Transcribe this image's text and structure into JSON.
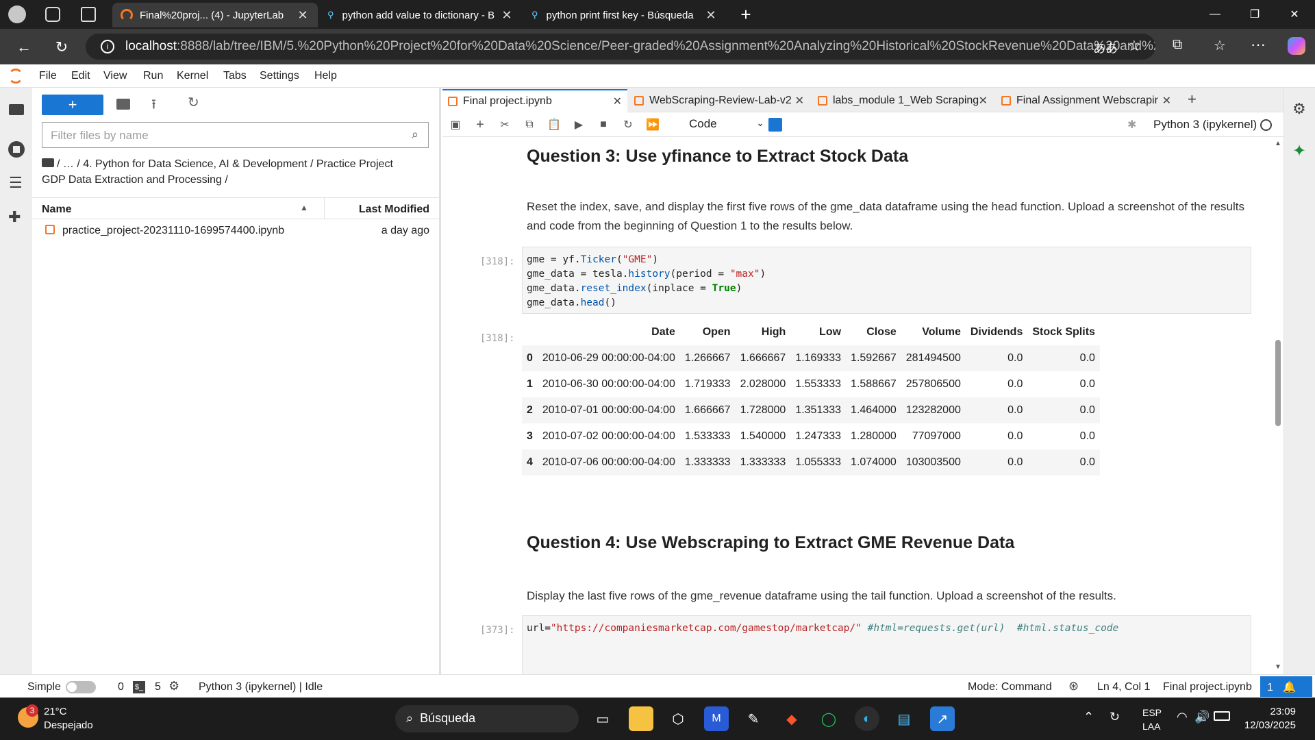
{
  "browser": {
    "tabs": [
      {
        "title": "Final%20proj... (4) - JupyterLab",
        "active": true
      },
      {
        "title": "python add value to dictionary - B",
        "active": false
      },
      {
        "title": "python print first key - Búsqueda",
        "active": false
      }
    ],
    "url_host": "localhost",
    "url_path": ":8888/lab/tree/IBM/5.%20Python%20Project%20for%20Data%20Science/Peer-graded%20Assignment%20Analyzing%20Historical%20StockRevenue%20Data%20and%20..."
  },
  "menubar": {
    "items": [
      "File",
      "Edit",
      "View",
      "Run",
      "Kernel",
      "Tabs",
      "Settings",
      "Help"
    ]
  },
  "filebrowser": {
    "new_label": "+",
    "filter_placeholder": "Filter files by name",
    "breadcrumb_line1": "/ … / 4. Python for Data Science, AI & Development / Practice Project",
    "breadcrumb_line2": "GDP Data Extraction and Processing /",
    "col_name": "Name",
    "col_modified": "Last Modified",
    "files": [
      {
        "name": "practice_project-20231110-1699574400.ipynb",
        "modified": "a day ago"
      }
    ]
  },
  "notebook_tabs": [
    {
      "label": "Final project.ipynb",
      "active": true
    },
    {
      "label": "WebScraping-Review-Lab-v2",
      "active": false
    },
    {
      "label": "labs_module 1_Web Scraping",
      "active": false
    },
    {
      "label": "Final Assignment Webscrapir",
      "active": false
    }
  ],
  "toolbar": {
    "cell_type": "Code",
    "kernel": "Python 3 (ipykernel)"
  },
  "cells": {
    "q3_heading": "Question 3: Use yfinance to Extract Stock Data",
    "q3_text": "Reset the index, save, and display the first five rows of the gme_data dataframe using the head function. Upload a screenshot of the results and code from the beginning of Question 1 to the results below.",
    "in_prompt_318": "[318]:",
    "out_prompt_318": "[318]:",
    "q4_heading": "Question 4: Use Webscraping to Extract GME Revenue Data",
    "q4_text": "Display the last five rows of the gme_revenue dataframe using the tail function. Upload a screenshot of the results.",
    "in_prompt_373": "[373]:"
  },
  "dataframe": {
    "columns": [
      "",
      "Date",
      "Open",
      "High",
      "Low",
      "Close",
      "Volume",
      "Dividends",
      "Stock Splits"
    ],
    "rows": [
      [
        "0",
        "2010-06-29 00:00:00-04:00",
        "1.266667",
        "1.666667",
        "1.169333",
        "1.592667",
        "281494500",
        "0.0",
        "0.0"
      ],
      [
        "1",
        "2010-06-30 00:00:00-04:00",
        "1.719333",
        "2.028000",
        "1.553333",
        "1.588667",
        "257806500",
        "0.0",
        "0.0"
      ],
      [
        "2",
        "2010-07-01 00:00:00-04:00",
        "1.666667",
        "1.728000",
        "1.351333",
        "1.464000",
        "123282000",
        "0.0",
        "0.0"
      ],
      [
        "3",
        "2010-07-02 00:00:00-04:00",
        "1.533333",
        "1.540000",
        "1.247333",
        "1.280000",
        "77097000",
        "0.0",
        "0.0"
      ],
      [
        "4",
        "2010-07-06 00:00:00-04:00",
        "1.333333",
        "1.333333",
        "1.055333",
        "1.074000",
        "103003500",
        "0.0",
        "0.0"
      ]
    ]
  },
  "statusbar": {
    "mode_simple": "Simple",
    "terminals": "0",
    "kernels": "5",
    "kernel_status": "Python 3 (ipykernel) | Idle",
    "mode": "Mode: Command",
    "cursor": "Ln 4, Col 1",
    "filename": "Final project.ipynb",
    "notifications": "1"
  },
  "taskbar": {
    "weather_temp": "21°C",
    "weather_desc": "Despejado",
    "weather_badge": "3",
    "search": "Búsqueda",
    "lang1": "ESP",
    "lang2": "LAA",
    "time": "23:09",
    "date": "12/03/2025"
  },
  "colors": {
    "jupyter_orange": "#f37726",
    "jupyter_blue": "#1976d2"
  }
}
